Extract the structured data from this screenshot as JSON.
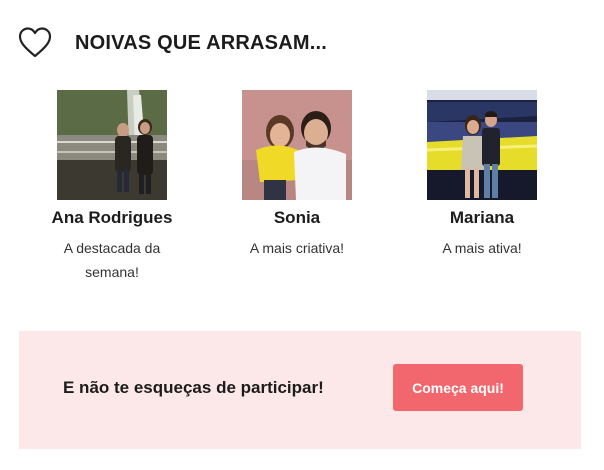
{
  "header": {
    "icon": "heart-outline-icon",
    "title": "NOIVAS QUE ARRASAM..."
  },
  "brides": [
    {
      "name": "Ana Rodrigues",
      "description": "A destacada da semana!"
    },
    {
      "name": "Sonia",
      "description": "A mais criativa!"
    },
    {
      "name": "Mariana",
      "description": "A mais ativa!"
    }
  ],
  "cta": {
    "text": "E não te esqueças de participar!",
    "button_label": "Começa aqui!"
  },
  "colors": {
    "cta_background": "#fde8e9",
    "cta_button": "#f1676d",
    "title_text": "#1c1c1c"
  }
}
